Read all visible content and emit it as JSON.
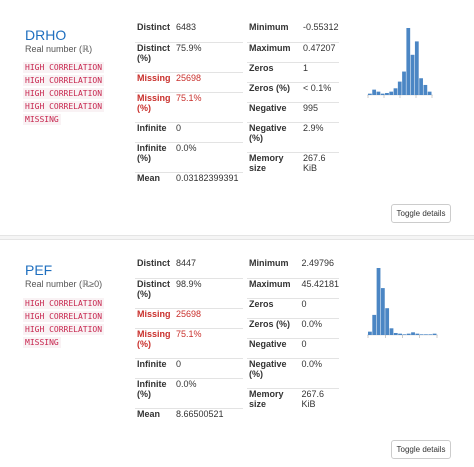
{
  "variables": [
    {
      "name": "DRHO",
      "type": "Real number (ℝ)",
      "warnings": [
        "HIGH CORRELATION",
        "HIGH CORRELATION",
        "HIGH CORRELATION",
        "HIGH CORRELATION",
        "MISSING"
      ],
      "left_stats": [
        {
          "key": "Distinct",
          "value": "6483"
        },
        {
          "key": "Distinct (%)",
          "value": "75.9%"
        },
        {
          "key": "Missing",
          "value": "25698"
        },
        {
          "key": "Missing (%)",
          "value": "75.1%"
        },
        {
          "key": "Infinite",
          "value": "0"
        },
        {
          "key": "Infinite (%)",
          "value": "0.0%"
        },
        {
          "key": "Mean",
          "value": "0.03182399391"
        }
      ],
      "right_stats": [
        {
          "key": "Minimum",
          "value": "-0.55312"
        },
        {
          "key": "Maximum",
          "value": "0.47207"
        },
        {
          "key": "Zeros",
          "value": "1"
        },
        {
          "key": "Zeros (%)",
          "value": "< 0.1%"
        },
        {
          "key": "Negative",
          "value": "995"
        },
        {
          "key": "Negative (%)",
          "value": "2.9%"
        },
        {
          "key": "Memory size",
          "value": "267.6 KiB"
        }
      ],
      "toggle_label": "Toggle details",
      "histogram_relative_heights": [
        0.02,
        0.08,
        0.05,
        0.02,
        0.03,
        0.05,
        0.1,
        0.2,
        0.35,
        1.0,
        0.6,
        0.8,
        0.25,
        0.15,
        0.05
      ]
    },
    {
      "name": "PEF",
      "type": "Real number (ℝ≥0)",
      "warnings": [
        "HIGH CORRELATION",
        "HIGH CORRELATION",
        "HIGH CORRELATION",
        "MISSING"
      ],
      "left_stats": [
        {
          "key": "Distinct",
          "value": "8447"
        },
        {
          "key": "Distinct (%)",
          "value": "98.9%"
        },
        {
          "key": "Missing",
          "value": "25698"
        },
        {
          "key": "Missing (%)",
          "value": "75.1%"
        },
        {
          "key": "Infinite",
          "value": "0"
        },
        {
          "key": "Infinite (%)",
          "value": "0.0%"
        },
        {
          "key": "Mean",
          "value": "8.66500521"
        }
      ],
      "right_stats": [
        {
          "key": "Minimum",
          "value": "2.49796"
        },
        {
          "key": "Maximum",
          "value": "45.42181"
        },
        {
          "key": "Zeros",
          "value": "0"
        },
        {
          "key": "Zeros (%)",
          "value": "0.0%"
        },
        {
          "key": "Negative",
          "value": "0"
        },
        {
          "key": "Negative (%)",
          "value": "0.0%"
        },
        {
          "key": "Memory size",
          "value": "267.6 KiB"
        }
      ],
      "toggle_label": "Toggle details",
      "histogram_relative_heights": [
        0.05,
        0.3,
        1.0,
        0.7,
        0.4,
        0.1,
        0.03,
        0.02,
        0.01,
        0.02,
        0.04,
        0.02,
        0.01,
        0.01,
        0.01,
        0.02
      ]
    }
  ],
  "colors": {
    "name": "#1f6fbf",
    "warning": "#c7254e",
    "missing": "#c9302c",
    "bar": "#4b86c4"
  }
}
